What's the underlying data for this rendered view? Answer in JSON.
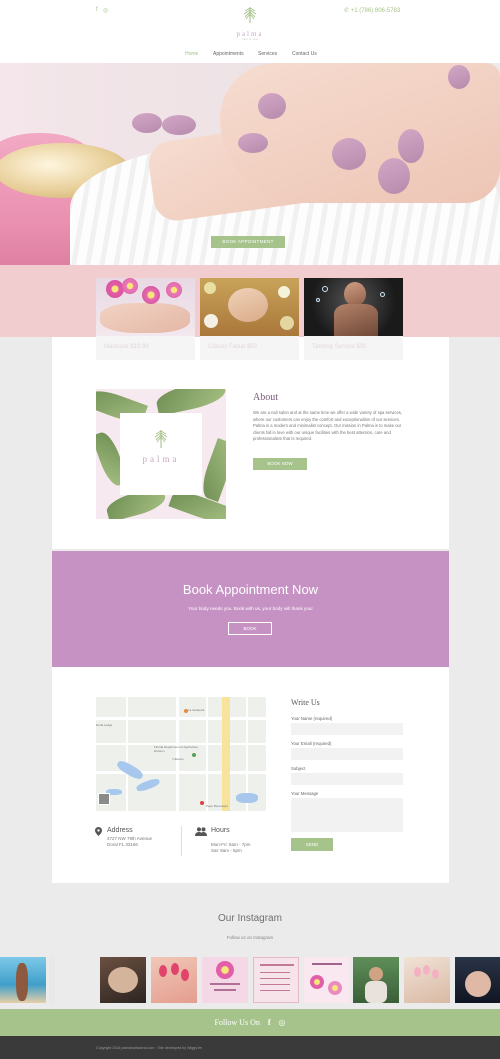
{
  "header": {
    "social": [
      "f",
      "◎"
    ],
    "phone": "+1 (786) 806-5783",
    "logo_brand": "palma",
    "logo_tag": "nail & spa",
    "nav": [
      "Home",
      "Appointments",
      "Services",
      "Contact Us"
    ]
  },
  "hero": {
    "button_label": "BOOK APPOINTMENT"
  },
  "services": [
    {
      "caption": "Manicure $19.99"
    },
    {
      "caption": "Classic Facial $50"
    },
    {
      "caption": "Tanning Service $30"
    }
  ],
  "about": {
    "title": "About",
    "text": "We are a nail salon and at the same time we offer a wide variety of spa services, where our customers can enjoy the comfort and exceptionalism of our services. Palma is a modern and minimalist concept. Our mission in Palma is to make our clients fall in love with our unique facilities with the best attention, care and professionalism that is required.",
    "button_label": "BOOK NOW",
    "logo_brand": "palma"
  },
  "booking": {
    "title": "Book Appointment Now",
    "subtitle": "Your body needs you. Book with us, your body will thank you!",
    "button_label": "BOOK"
  },
  "contact": {
    "address_title": "Address",
    "address_lines": [
      "4727 NW 79th Avenue",
      "Doral FL 33166"
    ],
    "hours_title": "Hours",
    "hours_lines": [
      "Mon-Fri: 8am - 7pm",
      "Sat: 8am - 6pm"
    ],
    "map_labels": [
      "La Gelateria",
      "Florida Department of Agriculture Division",
      "7-Eleven",
      "Pepe Beverages",
      "Doral Ledge"
    ],
    "form": {
      "title": "Write Us",
      "name_label": "Your Name (required)",
      "email_label": "Your Email (required)",
      "subject_label": "Subject",
      "message_label": "Your Message",
      "send_label": "SEND"
    }
  },
  "instagram": {
    "title": "Our Instagram",
    "subtitle": "Follow us on Instagram"
  },
  "follow": {
    "text": "Follow Us On",
    "icons": [
      "f",
      "◎"
    ]
  },
  "footer": {
    "copyright": "Copyright 2018 palmanailsdoral.com · Site developed by Wiggs.fm"
  },
  "colors": {
    "accent_green": "#a5c38a",
    "booking_purple": "#c692c4",
    "pink_band": "#f2cdd0"
  }
}
